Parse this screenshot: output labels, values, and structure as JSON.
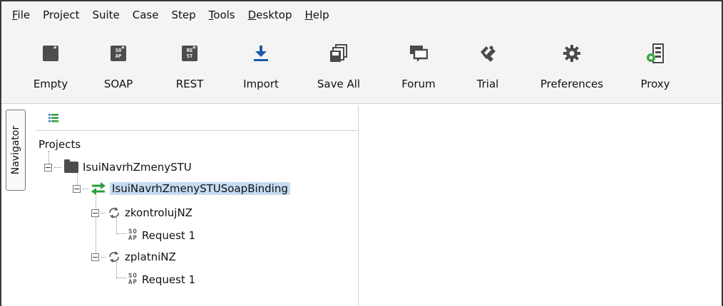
{
  "menubar": {
    "items": [
      {
        "mn": "F",
        "rest": "ile"
      },
      {
        "mn": "",
        "rest": "Project"
      },
      {
        "mn": "",
        "rest": "Suite"
      },
      {
        "mn": "",
        "rest": "Case"
      },
      {
        "mn": "",
        "rest": "Step"
      },
      {
        "mn": "T",
        "rest": "ools"
      },
      {
        "mn": "D",
        "rest": "esktop"
      },
      {
        "mn": "H",
        "rest": "elp"
      }
    ]
  },
  "toolbar": {
    "empty": {
      "label": "Empty",
      "icon": "empty-project-icon"
    },
    "soap": {
      "label": "SOAP",
      "icon_text_1": "SO",
      "icon_text_2": "AP"
    },
    "rest": {
      "label": "REST",
      "icon_text_1": "RE",
      "icon_text_2": "ST"
    },
    "import": {
      "label": "Import",
      "icon": "download-arrow-icon",
      "color": "#1a5aa8"
    },
    "save_all": {
      "label": "Save All",
      "icon": "save-all-icon"
    },
    "forum": {
      "label": "Forum",
      "icon": "speech-bubbles-icon"
    },
    "trial": {
      "label": "Trial",
      "icon": "trial-icon"
    },
    "preferences": {
      "label": "Preferences",
      "icon": "gear-icon"
    },
    "proxy": {
      "label": "Proxy",
      "icon": "proxy-server-icon",
      "color": "#3aa845"
    }
  },
  "navigator": {
    "tab_label": "Navigator",
    "tree": {
      "root": "Projects",
      "project": "IsuiNavrhZmenySTU",
      "binding": "IsuiNavrhZmenySTUSoapBinding",
      "operations": [
        {
          "name": "zkontrolujNZ",
          "request": "Request 1"
        },
        {
          "name": "zplatniNZ",
          "request": "Request 1"
        }
      ],
      "soap_icon_1": "SO",
      "soap_icon_2": "AP"
    }
  },
  "colors": {
    "selection": "#c5dcf2",
    "binding_icon": "#27a13a",
    "import_icon": "#1a5aa8"
  }
}
